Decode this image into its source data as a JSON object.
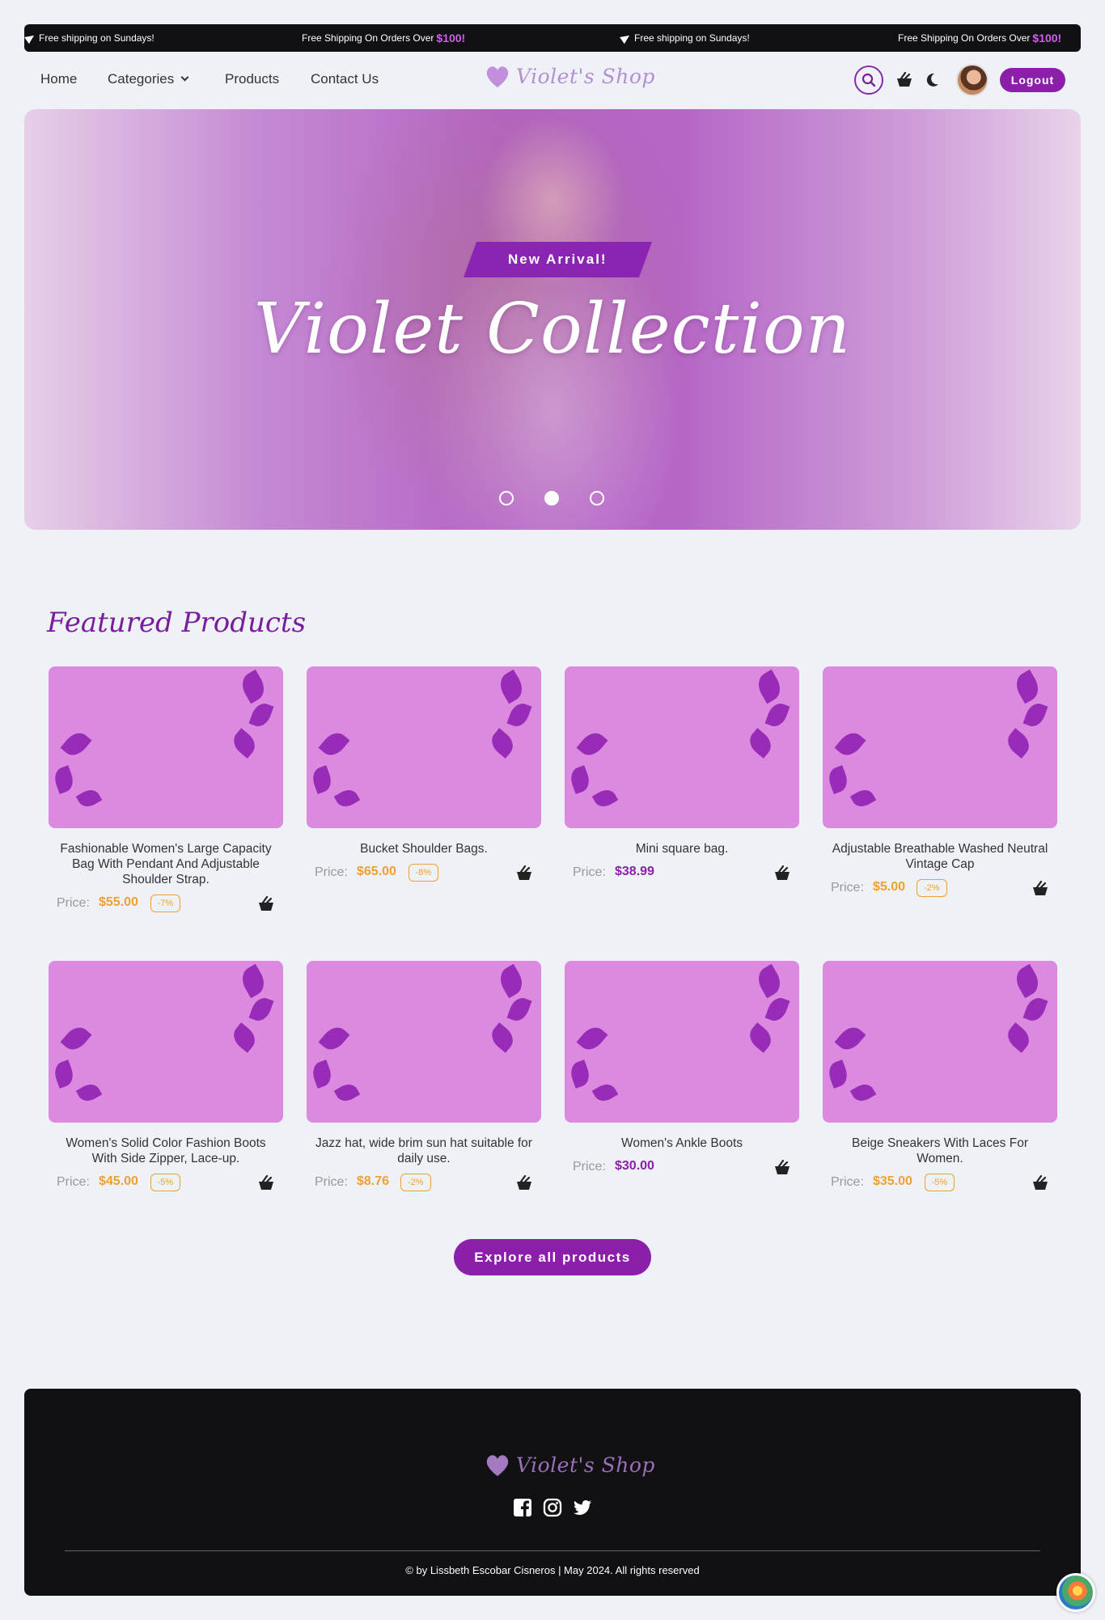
{
  "topbar": {
    "msg1": "Free shipping on Sundays!",
    "msg2_prefix": "Free Shipping On Orders Over",
    "msg2_amount": "$100!",
    "msg3": "Free shipping on Sundays!",
    "msg4_prefix": "Free Shipping On Orders Over",
    "msg4_amount": "$100!"
  },
  "nav": {
    "home": "Home",
    "categories": "Categories",
    "products": "Products",
    "contact": "Contact Us",
    "logo": "Violet's Shop",
    "logout": "Logout"
  },
  "hero": {
    "tag": "New Arrival!",
    "title": "Violet Collection",
    "active_slide": 2,
    "slide_count": 3
  },
  "featured": {
    "title": "Featured Products",
    "products": [
      {
        "name": "Fashionable Women's Large Capacity Bag With Pendant And Adjustable Shoulder Strap.",
        "price_label": "Price:",
        "price": "$55.00",
        "discount": "-7%"
      },
      {
        "name": "Bucket Shoulder Bags.",
        "price_label": "Price:",
        "price": "$65.00",
        "discount": "-8%"
      },
      {
        "name": "Mini square bag.",
        "price_label": "Price:",
        "price": "$38.99",
        "discount": ""
      },
      {
        "name": "Adjustable Breathable Washed Neutral Vintage Cap",
        "price_label": "Price:",
        "price": "$5.00",
        "discount": "-2%"
      },
      {
        "name": "Women's Solid Color Fashion Boots With Side Zipper, Lace-up.",
        "price_label": "Price:",
        "price": "$45.00",
        "discount": "-5%"
      },
      {
        "name": "Jazz hat, wide brim sun hat suitable for daily use.",
        "price_label": "Price:",
        "price": "$8.76",
        "discount": "-2%"
      },
      {
        "name": "Women's Ankle Boots",
        "price_label": "Price:",
        "price": "$30.00",
        "discount": ""
      },
      {
        "name": "Beige Sneakers With Laces For Women.",
        "price_label": "Price:",
        "price": "$35.00",
        "discount": "-5%"
      }
    ],
    "explore": "Explore all products"
  },
  "footer": {
    "logo": "Violet's Shop",
    "copyright": "© by Lissbeth Escobar Cisneros | May 2024. All rights reserved"
  },
  "colors": {
    "accent": "#8b1fa9",
    "discounted_price": "#f0a030",
    "regular_price": "#8b1fa9",
    "card_bg": "#dc8ae0",
    "dark": "#111114"
  },
  "icons": [
    "send-icon",
    "chevron-down-icon",
    "heart-logo-icon",
    "search-icon",
    "basket-icon",
    "moon-icon",
    "facebook-icon",
    "instagram-icon",
    "twitter-icon"
  ]
}
